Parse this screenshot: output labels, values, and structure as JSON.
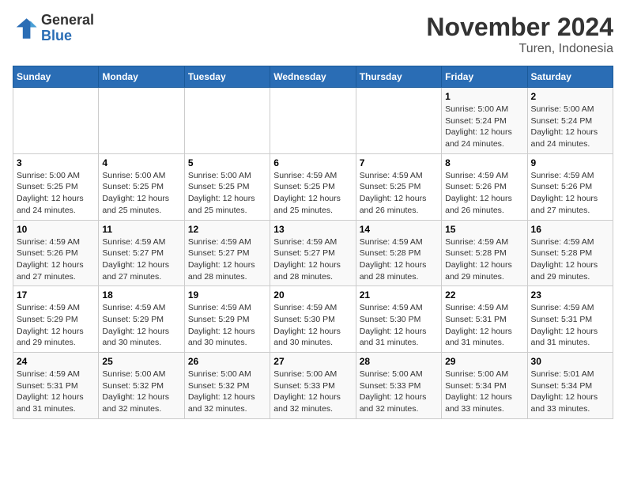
{
  "logo": {
    "line1": "General",
    "line2": "Blue"
  },
  "title": "November 2024",
  "subtitle": "Turen, Indonesia",
  "weekdays": [
    "Sunday",
    "Monday",
    "Tuesday",
    "Wednesday",
    "Thursday",
    "Friday",
    "Saturday"
  ],
  "weeks": [
    [
      {
        "day": "",
        "info": ""
      },
      {
        "day": "",
        "info": ""
      },
      {
        "day": "",
        "info": ""
      },
      {
        "day": "",
        "info": ""
      },
      {
        "day": "",
        "info": ""
      },
      {
        "day": "1",
        "info": "Sunrise: 5:00 AM\nSunset: 5:24 PM\nDaylight: 12 hours\nand 24 minutes."
      },
      {
        "day": "2",
        "info": "Sunrise: 5:00 AM\nSunset: 5:24 PM\nDaylight: 12 hours\nand 24 minutes."
      }
    ],
    [
      {
        "day": "3",
        "info": "Sunrise: 5:00 AM\nSunset: 5:25 PM\nDaylight: 12 hours\nand 24 minutes."
      },
      {
        "day": "4",
        "info": "Sunrise: 5:00 AM\nSunset: 5:25 PM\nDaylight: 12 hours\nand 25 minutes."
      },
      {
        "day": "5",
        "info": "Sunrise: 5:00 AM\nSunset: 5:25 PM\nDaylight: 12 hours\nand 25 minutes."
      },
      {
        "day": "6",
        "info": "Sunrise: 4:59 AM\nSunset: 5:25 PM\nDaylight: 12 hours\nand 25 minutes."
      },
      {
        "day": "7",
        "info": "Sunrise: 4:59 AM\nSunset: 5:25 PM\nDaylight: 12 hours\nand 26 minutes."
      },
      {
        "day": "8",
        "info": "Sunrise: 4:59 AM\nSunset: 5:26 PM\nDaylight: 12 hours\nand 26 minutes."
      },
      {
        "day": "9",
        "info": "Sunrise: 4:59 AM\nSunset: 5:26 PM\nDaylight: 12 hours\nand 27 minutes."
      }
    ],
    [
      {
        "day": "10",
        "info": "Sunrise: 4:59 AM\nSunset: 5:26 PM\nDaylight: 12 hours\nand 27 minutes."
      },
      {
        "day": "11",
        "info": "Sunrise: 4:59 AM\nSunset: 5:27 PM\nDaylight: 12 hours\nand 27 minutes."
      },
      {
        "day": "12",
        "info": "Sunrise: 4:59 AM\nSunset: 5:27 PM\nDaylight: 12 hours\nand 28 minutes."
      },
      {
        "day": "13",
        "info": "Sunrise: 4:59 AM\nSunset: 5:27 PM\nDaylight: 12 hours\nand 28 minutes."
      },
      {
        "day": "14",
        "info": "Sunrise: 4:59 AM\nSunset: 5:28 PM\nDaylight: 12 hours\nand 28 minutes."
      },
      {
        "day": "15",
        "info": "Sunrise: 4:59 AM\nSunset: 5:28 PM\nDaylight: 12 hours\nand 29 minutes."
      },
      {
        "day": "16",
        "info": "Sunrise: 4:59 AM\nSunset: 5:28 PM\nDaylight: 12 hours\nand 29 minutes."
      }
    ],
    [
      {
        "day": "17",
        "info": "Sunrise: 4:59 AM\nSunset: 5:29 PM\nDaylight: 12 hours\nand 29 minutes."
      },
      {
        "day": "18",
        "info": "Sunrise: 4:59 AM\nSunset: 5:29 PM\nDaylight: 12 hours\nand 30 minutes."
      },
      {
        "day": "19",
        "info": "Sunrise: 4:59 AM\nSunset: 5:29 PM\nDaylight: 12 hours\nand 30 minutes."
      },
      {
        "day": "20",
        "info": "Sunrise: 4:59 AM\nSunset: 5:30 PM\nDaylight: 12 hours\nand 30 minutes."
      },
      {
        "day": "21",
        "info": "Sunrise: 4:59 AM\nSunset: 5:30 PM\nDaylight: 12 hours\nand 31 minutes."
      },
      {
        "day": "22",
        "info": "Sunrise: 4:59 AM\nSunset: 5:31 PM\nDaylight: 12 hours\nand 31 minutes."
      },
      {
        "day": "23",
        "info": "Sunrise: 4:59 AM\nSunset: 5:31 PM\nDaylight: 12 hours\nand 31 minutes."
      }
    ],
    [
      {
        "day": "24",
        "info": "Sunrise: 4:59 AM\nSunset: 5:31 PM\nDaylight: 12 hours\nand 31 minutes."
      },
      {
        "day": "25",
        "info": "Sunrise: 5:00 AM\nSunset: 5:32 PM\nDaylight: 12 hours\nand 32 minutes."
      },
      {
        "day": "26",
        "info": "Sunrise: 5:00 AM\nSunset: 5:32 PM\nDaylight: 12 hours\nand 32 minutes."
      },
      {
        "day": "27",
        "info": "Sunrise: 5:00 AM\nSunset: 5:33 PM\nDaylight: 12 hours\nand 32 minutes."
      },
      {
        "day": "28",
        "info": "Sunrise: 5:00 AM\nSunset: 5:33 PM\nDaylight: 12 hours\nand 32 minutes."
      },
      {
        "day": "29",
        "info": "Sunrise: 5:00 AM\nSunset: 5:34 PM\nDaylight: 12 hours\nand 33 minutes."
      },
      {
        "day": "30",
        "info": "Sunrise: 5:01 AM\nSunset: 5:34 PM\nDaylight: 12 hours\nand 33 minutes."
      }
    ]
  ]
}
